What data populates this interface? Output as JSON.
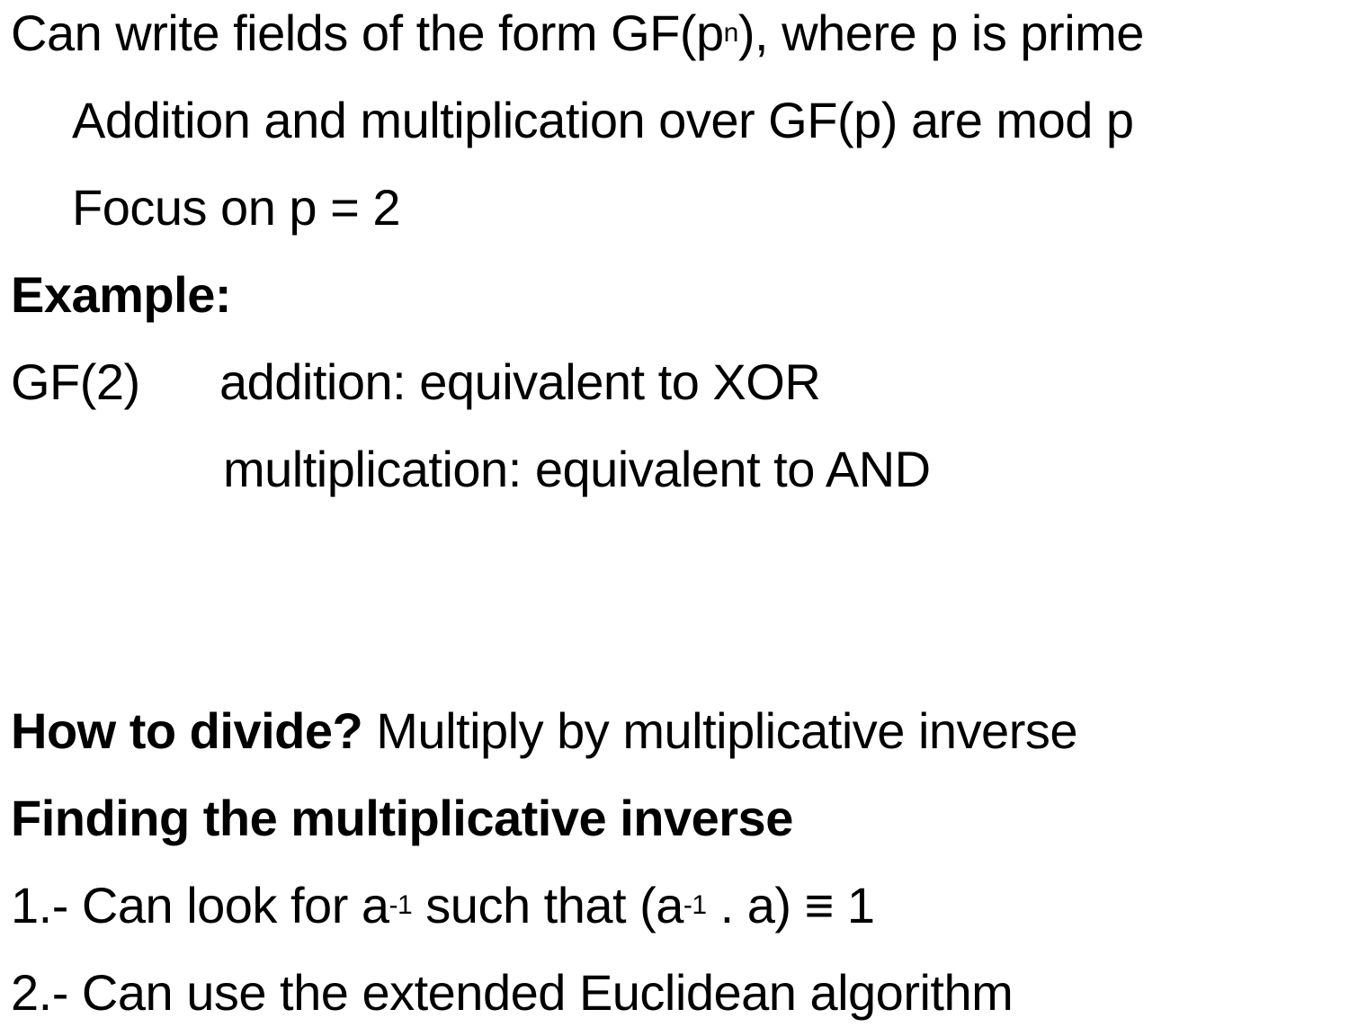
{
  "slide": {
    "line1": {
      "before_sup": "Can write fields of the form GF(p",
      "sup": "n",
      "after_sup": "), where p is prime"
    },
    "line2": "Addition and multiplication over GF(p) are mod p",
    "line3": "Focus on p = 2",
    "example_heading": "Example:",
    "gf2_label": "GF(2)",
    "gf2_addition": "addition: equivalent to XOR",
    "gf2_multiplication": "multiplication: equivalent to AND",
    "divide_question": "How to divide?",
    "divide_answer": " Multiply by multiplicative inverse",
    "finding_heading": "Finding the multiplicative inverse",
    "step1": {
      "part1": "1.- Can look for a",
      "sup1": "-1",
      "part2": " such that (a",
      "sup2": "-1",
      "part3": " . a) ≡ 1"
    },
    "step2": "2.- Can use the extended Euclidean algorithm"
  }
}
